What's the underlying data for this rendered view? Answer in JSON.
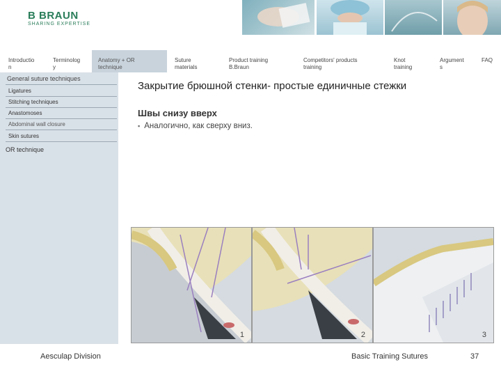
{
  "brand": {
    "logo": "B BRAUN",
    "tagline": "SHARING EXPERTISE"
  },
  "nav": [
    {
      "label": "Introductio\nn"
    },
    {
      "label": "Terminolog\ny"
    },
    {
      "label": "Anatomy + OR\ntechnique"
    },
    {
      "label": "Suture\nmaterials"
    },
    {
      "label": "Product training\nB.Braun"
    },
    {
      "label": "Competitors' products\ntraining"
    },
    {
      "label": "Knot\ntraining"
    },
    {
      "label": "Argument\ns"
    },
    {
      "label": "FAQ"
    }
  ],
  "sidebar": {
    "section": "General suture techniques",
    "items": [
      {
        "label": "Ligatures"
      },
      {
        "label": "Stitching techniques"
      },
      {
        "label": "Anastomoses"
      },
      {
        "label": "Abdominal wall closure"
      },
      {
        "label": "Skin sutures"
      }
    ],
    "or_technique": "OR technique"
  },
  "content": {
    "title": "Закрытие брюшной стенки- простые единичные стежки",
    "subtitle": "Швы снизу вверх",
    "bullet": "Аналогично, как сверху вниз."
  },
  "panels": [
    {
      "number": "1"
    },
    {
      "number": "2"
    },
    {
      "number": "3"
    }
  ],
  "footer": {
    "division": "Aesculap Division",
    "course": "Basic Training Sutures",
    "page": "37"
  },
  "colors": {
    "brand_green": "#2a7d5a",
    "sidebar": "#d9e1e8",
    "nav_active": "#c8d3dc"
  }
}
